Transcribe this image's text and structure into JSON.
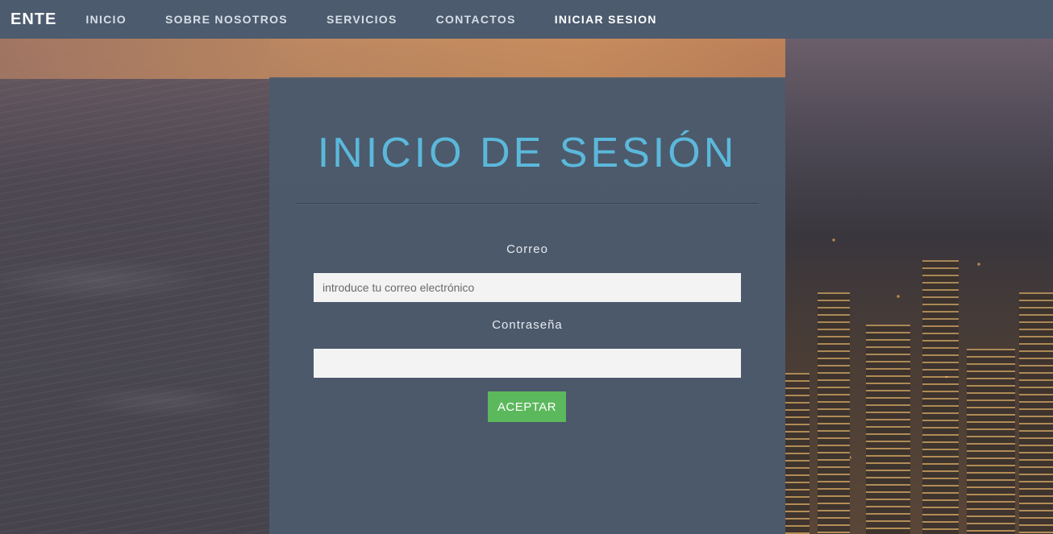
{
  "nav": {
    "brand": "ENTE",
    "links": [
      {
        "label": "INICIO"
      },
      {
        "label": "SOBRE NOSOTROS"
      },
      {
        "label": "SERVICIOS"
      },
      {
        "label": "CONTACTOS"
      },
      {
        "label": "INICIAR SESION",
        "active": true
      }
    ]
  },
  "login": {
    "title": "INICIO DE SESIÓN",
    "email_label": "Correo",
    "email_placeholder": "introduce tu correo electrónico",
    "email_value": "",
    "password_label": "Contraseña",
    "password_value": "",
    "submit_label": "ACEPTAR"
  },
  "colors": {
    "nav_bg": "#4c5b6e",
    "title": "#5bb8da",
    "button": "#5cb85c"
  }
}
